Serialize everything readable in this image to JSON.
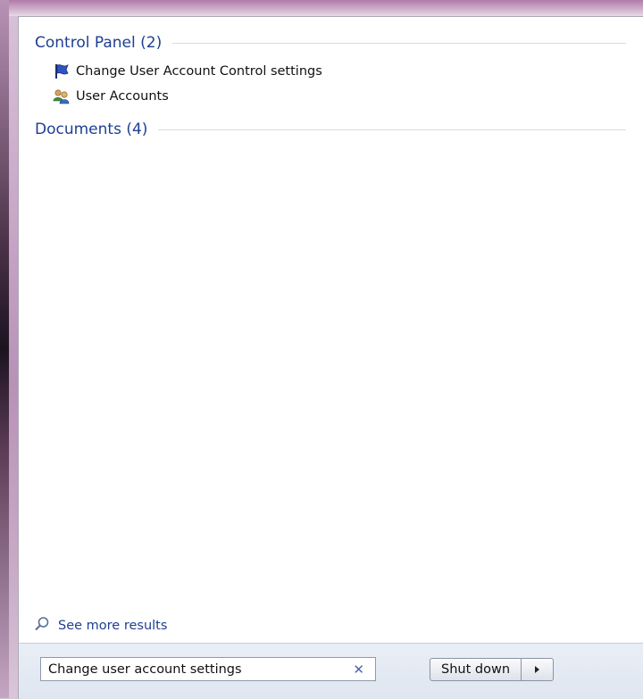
{
  "groups": [
    {
      "title": "Control Panel (2)",
      "items": [
        {
          "label": "Change User Account Control settings",
          "icon": "uac-flag-icon"
        },
        {
          "label": "User Accounts",
          "icon": "user-accounts-icon"
        }
      ]
    },
    {
      "title": "Documents (4)",
      "items": []
    }
  ],
  "see_more": {
    "label": "See more results",
    "icon": "search-icon"
  },
  "search": {
    "value": "Change user account settings",
    "clear_icon": "clear-icon"
  },
  "shutdown": {
    "label": "Shut down",
    "arrow_icon": "arrow-right-icon"
  },
  "colors": {
    "header_text": "#1e3f92",
    "accent": "#4a6aa8"
  }
}
